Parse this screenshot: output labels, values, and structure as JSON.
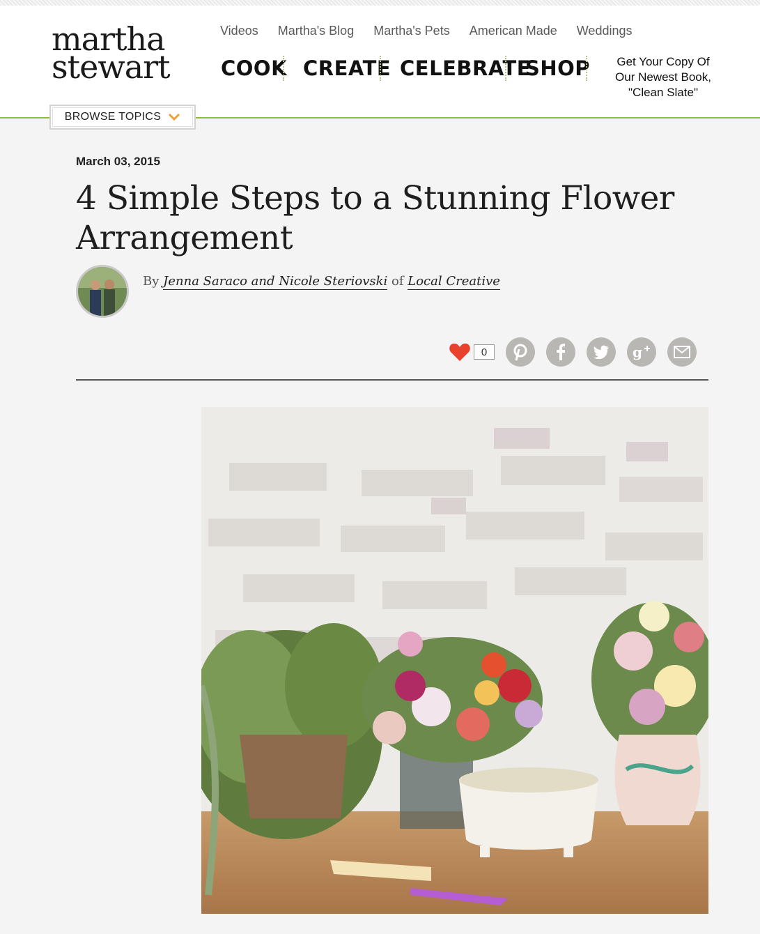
{
  "logo": {
    "line1": "martha",
    "line2": "stewart"
  },
  "subnav": [
    "Videos",
    "Martha's Blog",
    "Martha's Pets",
    "American Made",
    "Weddings"
  ],
  "mainnav": [
    "COOK",
    "CREATE",
    "CELEBRATE",
    "SHOP"
  ],
  "promo": {
    "line1": "Get Your Copy Of",
    "line2": "Our Newest Book,",
    "line3": "\"Clean Slate\""
  },
  "browse": {
    "label": "BROWSE TOPICS"
  },
  "article": {
    "date": "March 03, 2015",
    "title": "4 Simple Steps to a Stunning Flower Arrangement",
    "by": "By",
    "authors": "Jenna Saraco and Nicole Steriovski",
    "of": "of",
    "organization": "Local Creative"
  },
  "share": {
    "like_count": "0",
    "buttons": [
      "pinterest-icon",
      "facebook-icon",
      "twitter-icon",
      "google-plus-icon",
      "email-icon"
    ]
  },
  "colors": {
    "accent_green": "#8dbb3a",
    "heart_red": "#e8412c",
    "share_gray": "#b9b7b3",
    "chevron_orange": "#e8a33c"
  }
}
